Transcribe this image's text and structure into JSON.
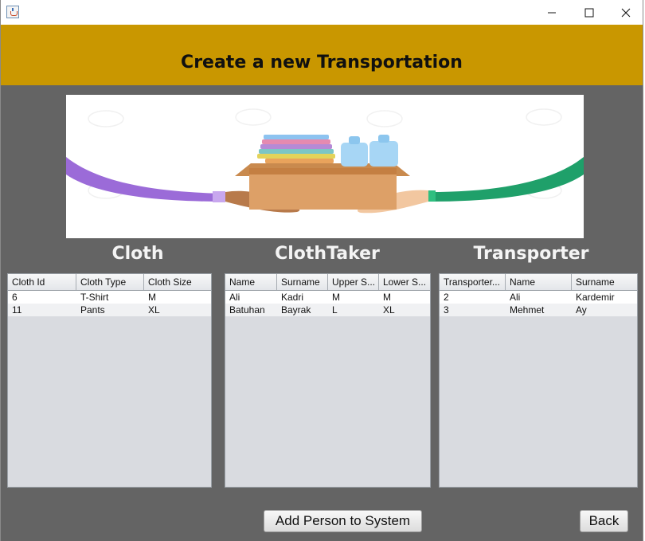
{
  "window": {
    "title": "",
    "controls": {
      "minimize": "minimize-icon",
      "maximize": "maximize-icon",
      "close": "close-icon"
    }
  },
  "header": {
    "title": "Create a new Transportation",
    "color": "#c99700"
  },
  "colors": {
    "background": "#646464",
    "table_bg": "#d9dbe0",
    "purple_band": "#9b6bd8",
    "green_band": "#1fa06a"
  },
  "sections": {
    "cloth": {
      "title": "Cloth",
      "columns": [
        "Cloth Id",
        "Cloth Type",
        "Cloth Size"
      ],
      "rows": [
        [
          "6",
          "T-Shirt",
          "M"
        ],
        [
          "11",
          "Pants",
          "XL"
        ]
      ]
    },
    "cloth_taker": {
      "title": "ClothTaker",
      "columns": [
        "Name",
        "Surname",
        "Upper S...",
        "Lower S..."
      ],
      "rows": [
        [
          "Ali",
          "Kadri",
          "M",
          "M"
        ],
        [
          "Batuhan",
          "Bayrak",
          "L",
          "XL"
        ]
      ]
    },
    "transporter": {
      "title": "Transporter",
      "columns": [
        "Transporter...",
        "Name",
        "Surname"
      ],
      "rows": [
        [
          "2",
          "Ali",
          "Kardemir"
        ],
        [
          "3",
          "Mehmet",
          "Ay"
        ]
      ]
    }
  },
  "buttons": {
    "add_person": "Add Person to System",
    "back": "Back"
  }
}
